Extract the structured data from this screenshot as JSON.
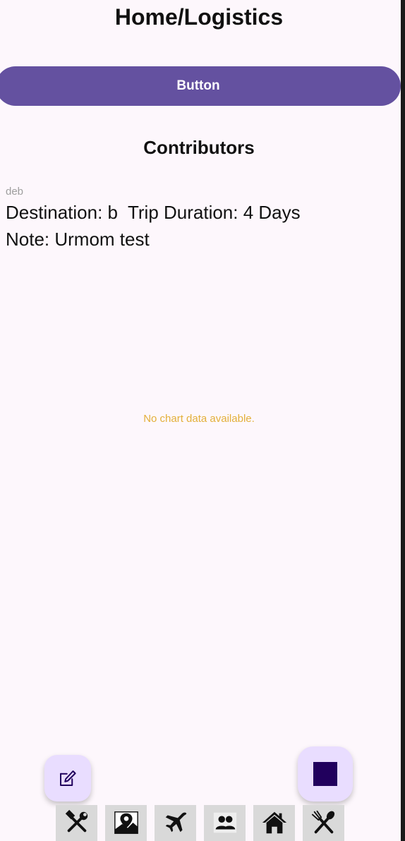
{
  "header": {
    "title": "Home/Logistics"
  },
  "primary_button": {
    "label": "Button"
  },
  "contributors": {
    "heading": "Contributors",
    "entries": [
      {
        "author": "deb",
        "destination_line": "Destination: b  Trip Duration: 4 Days",
        "note_line": "Note: Urmom test"
      }
    ]
  },
  "chart": {
    "empty_message": "No chart data available."
  },
  "fabs": {
    "edit_icon": "edit-icon",
    "stop_icon": "stop-icon"
  },
  "bottom_nav": {
    "items": [
      {
        "icon": "tools-icon"
      },
      {
        "icon": "map-pin-icon"
      },
      {
        "icon": "airplane-icon"
      },
      {
        "icon": "people-icon"
      },
      {
        "icon": "house-icon"
      },
      {
        "icon": "fork-spoon-icon"
      }
    ]
  },
  "colors": {
    "background": "#fdf7fc",
    "button": "#6451a0",
    "fab": "#e9ddff",
    "stop": "#21005d",
    "empty_message": "#e3b03a",
    "author": "#9e9e9e"
  }
}
